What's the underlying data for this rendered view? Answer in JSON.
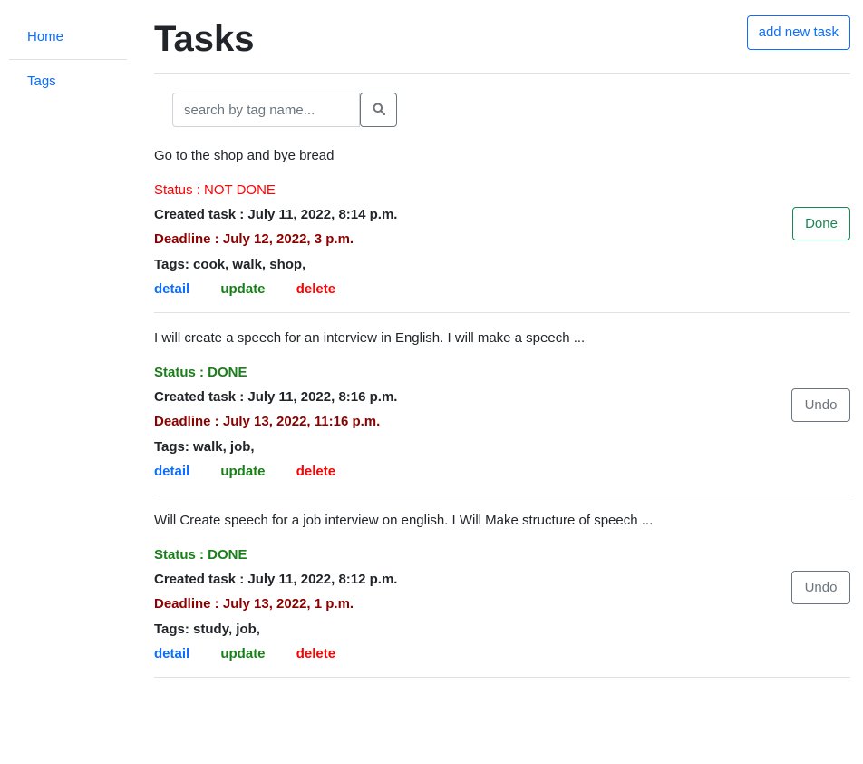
{
  "sidebar": {
    "items": [
      {
        "label": "Home"
      },
      {
        "label": "Tags"
      }
    ]
  },
  "header": {
    "title": "Tasks",
    "add_button": "add new task"
  },
  "search": {
    "placeholder": "search by tag name...",
    "icon": "search-icon"
  },
  "tasks": [
    {
      "description": "Go to the shop and bye bread",
      "status": "Status : NOT DONE",
      "created": "Created task : July 11, 2022, 8:14 p.m.",
      "deadline": "Deadline : July 12, 2022, 3 p.m.",
      "tags": "Tags: cook, walk, shop,",
      "detail": "detail",
      "update": "update",
      "delete": "delete",
      "action": "Done"
    },
    {
      "description": "I will create a speech for an interview in English. I will make a speech ...",
      "status": "Status : DONE",
      "created": "Created task : July 11, 2022, 8:16 p.m.",
      "deadline": "Deadline : July 13, 2022, 11:16 p.m.",
      "tags": "Tags: walk, job,",
      "detail": "detail",
      "update": "update",
      "delete": "delete",
      "action": "Undo"
    },
    {
      "description": "Will Create speech for a job interview on english. I Will Make structure of speech ...",
      "status": "Status : DONE",
      "created": "Created task : July 11, 2022, 8:12 p.m.",
      "deadline": "Deadline : July 13, 2022, 1 p.m.",
      "tags": "Tags: study, job,",
      "detail": "detail",
      "update": "update",
      "delete": "delete",
      "action": "Undo"
    }
  ],
  "colors": {
    "link": "#0d6efd",
    "done": "#198019",
    "not_done": "#ff0000",
    "deadline": "#8b0000"
  }
}
